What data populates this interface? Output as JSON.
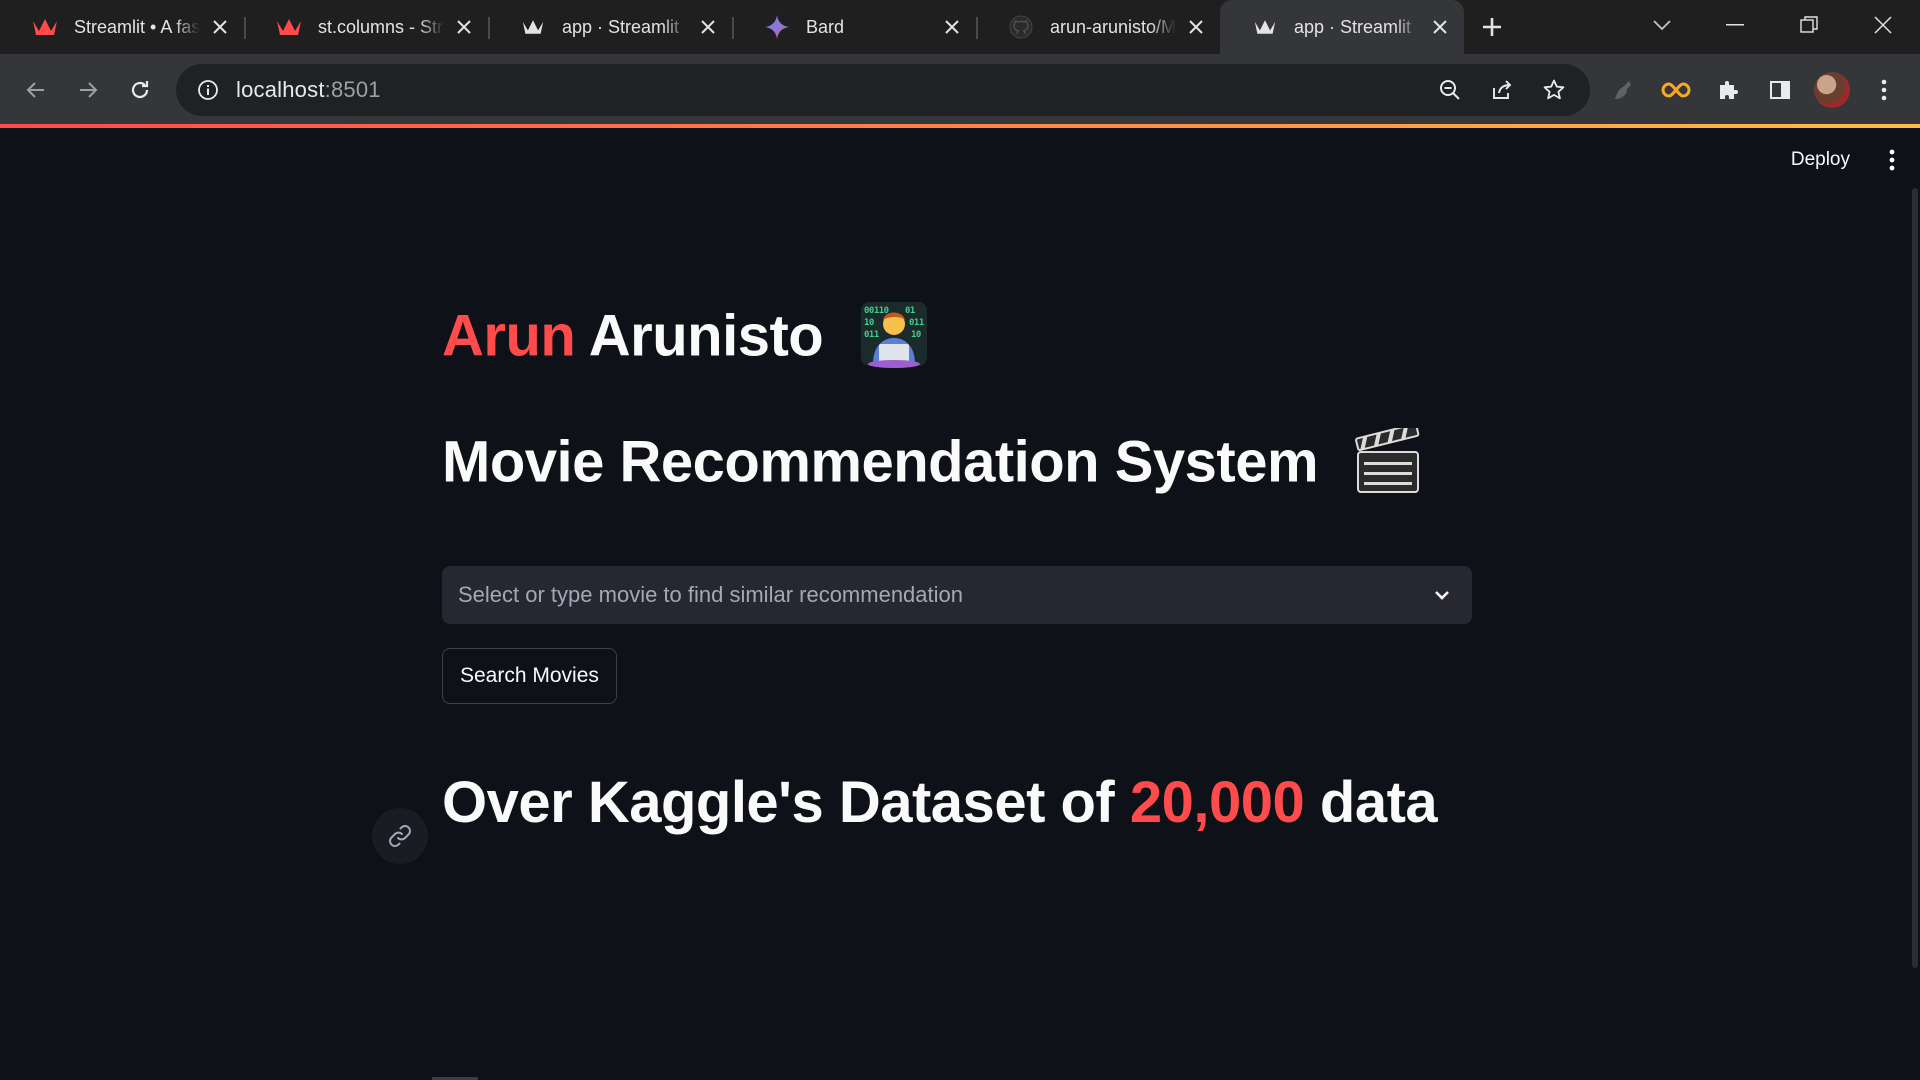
{
  "browser": {
    "tabs": [
      {
        "title": "Streamlit • A faster way to build and share data apps",
        "icon": "streamlit-crown-red-icon",
        "active": false
      },
      {
        "title": "st.columns - Streamlit Docs",
        "icon": "streamlit-crown-red-icon",
        "active": false
      },
      {
        "title": "app · Streamlit",
        "icon": "streamlit-crown-white-icon",
        "active": false
      },
      {
        "title": "Bard",
        "icon": "bard-sparkle-icon",
        "active": false
      },
      {
        "title": "arun-arunisto/Movie",
        "icon": "github-icon",
        "active": false
      },
      {
        "title": "app · Streamlit",
        "icon": "streamlit-crown-white-icon",
        "active": true
      }
    ],
    "address": {
      "host": "localhost",
      "port": ":8501"
    },
    "accent_colors": {
      "tabstrip": "#1f1f1f",
      "toolbar": "#35363a",
      "omnibox": "#202124"
    }
  },
  "app": {
    "deploy_label": "Deploy",
    "name_first": "Arun",
    "name_last": "Arunisto",
    "title": "Movie Recommendation System",
    "select_placeholder": "Select or type movie to find similar recommendation",
    "search_button": "Search Movies",
    "stat_prefix": "Over Kaggle's Dataset of ",
    "stat_highlight": "20,000",
    "stat_suffix": " data",
    "colors": {
      "background": "#0e1117",
      "primary": "#ff4b4b",
      "widget": "#262730",
      "text": "#fafafa"
    }
  }
}
